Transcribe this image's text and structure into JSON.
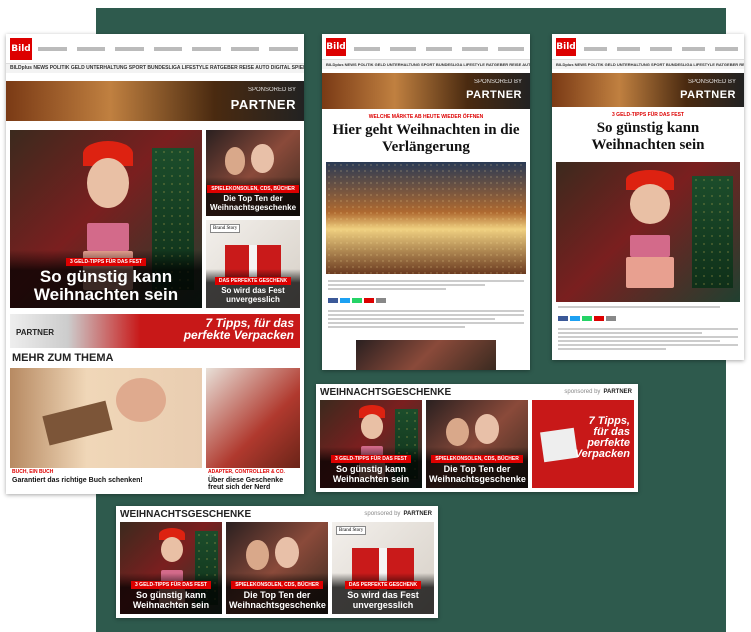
{
  "homepage": {
    "logo": "Bild",
    "nav": "BILDplus NEWS POLITIK GELD UNTERHALTUNG SPORT BUNDESLIGA LIFESTYLE RATGEBER REISE AUTO DIGITAL SPIELE MUSIK VIDEO",
    "sponsor_by": "SPONSORED BY",
    "sponsor_partner": "PARTNER",
    "hero_kicker": "3 GELD-TIPPS FÜR DAS FEST",
    "hero_title": "So günstig kann Weihnachten sein",
    "teaser1_kicker": "SPIELEKONSOLEN, CDS, BÜCHER",
    "teaser1_title": "Die Top Ten der Weihnachtsgeschenke",
    "teaser2_badge": "Brand Story",
    "teaser2_kicker": "DAS PERFEKTE GESCHENK",
    "teaser2_title": "So wird das Fest unvergesslich",
    "banner_partner": "PARTNER",
    "banner_text": "7 Tipps, für das perfekte Verpacken",
    "mehr_heading": "MEHR ZUM THEMA",
    "item1_kicker": "BUCH, EIN BUCH",
    "item1_title": "Garantiert das richtige Buch schenken!",
    "item2_kicker": "ADAPTER, CONTROLLER & CO.",
    "item2_title": "Über diese Geschenke freut sich der Nerd"
  },
  "article1": {
    "logo": "Bild",
    "sponsor_by": "SPONSORED BY",
    "sponsor_partner": "PARTNER",
    "kicker": "WELCHE MÄRKTE AB HEUTE WIEDER ÖFFNEN",
    "title": "Hier geht Weihnachten in die Verlängerung"
  },
  "article2": {
    "logo": "Bild",
    "sponsor_by": "SPONSORED BY",
    "sponsor_partner": "PARTNER",
    "kicker": "3 GELD-TIPPS FÜR DAS FEST",
    "title": "So günstig kann Weihnachten sein"
  },
  "widget1": {
    "heading": "WEIHNACHTSGESCHENKE",
    "sponsored": "sponsored by",
    "partner": "PARTNER",
    "tile1_kicker": "3 GELD-TIPPS FÜR DAS FEST",
    "tile1_title": "So günstig kann Weihnachten sein",
    "tile2_kicker": "SPIELEKONSOLEN, CDS, BÜCHER",
    "tile2_title": "Die Top Ten der Weihnachtsgeschenke",
    "tile3_text": "7 Tipps, für das perfekte Verpacken"
  },
  "widget2": {
    "heading": "WEIHNACHTSGESCHENKE",
    "sponsored": "sponsored by",
    "partner": "PARTNER",
    "tile1_kicker": "3 GELD-TIPPS FÜR DAS FEST",
    "tile1_title": "So günstig kann Weihnachten sein",
    "tile2_kicker": "SPIELEKONSOLEN, CDS, BÜCHER",
    "tile2_title": "Die Top Ten der Weihnachtsgeschenke",
    "tile3_badge": "Brand Story",
    "tile3_kicker": "DAS PERFEKTE GESCHENK",
    "tile3_title": "So wird das Fest unvergesslich"
  },
  "colors": {
    "bild_red": "#dd0000",
    "background_green": "#2e5a4d"
  }
}
